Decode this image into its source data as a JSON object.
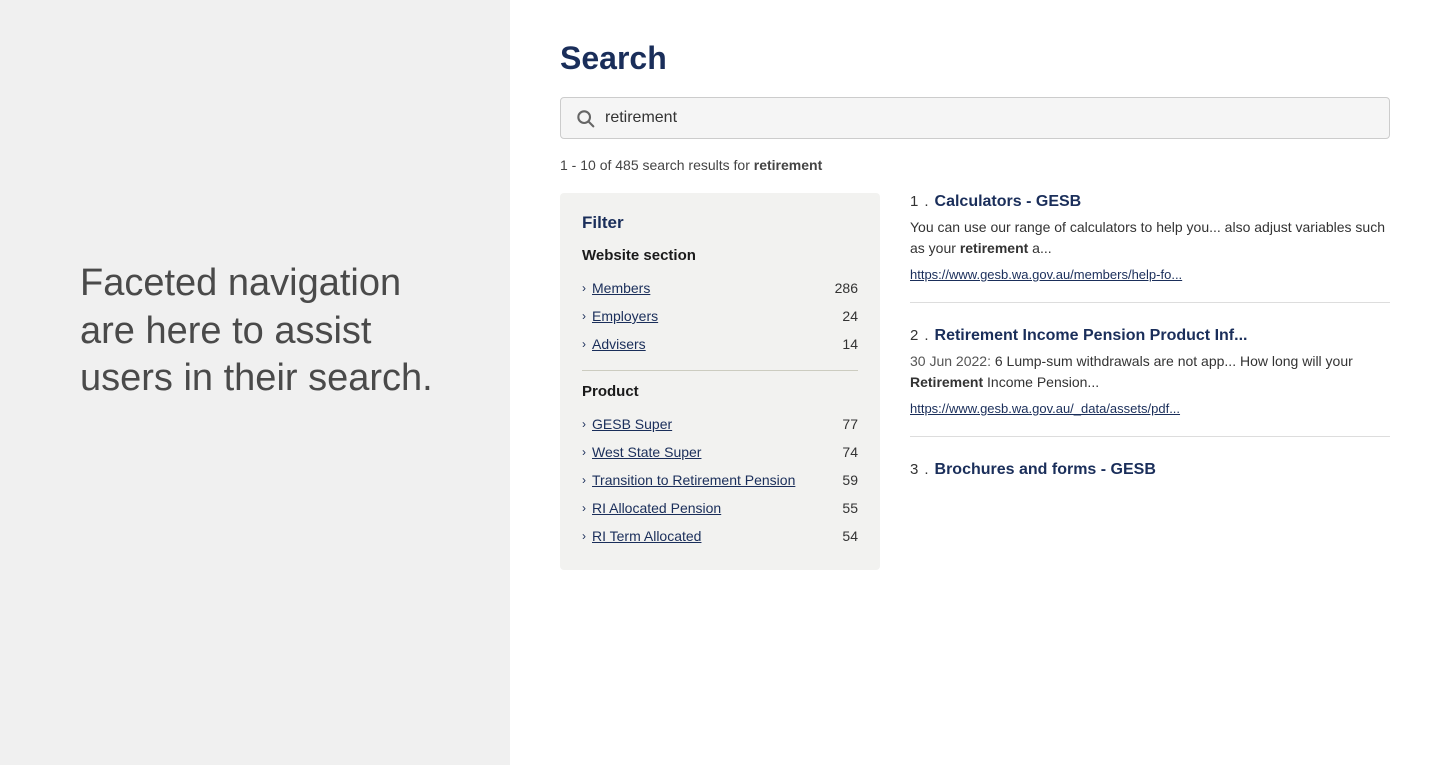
{
  "left_panel": {
    "description": "Faceted navigation are here to assist users in their search."
  },
  "search": {
    "heading": "Search",
    "query": "retirement",
    "results_summary_prefix": "1 - 10 of 485 search results for",
    "results_query_bold": "retirement"
  },
  "filter": {
    "title": "Filter",
    "sections": [
      {
        "label": "Website section",
        "items": [
          {
            "name": "Members",
            "count": 286
          },
          {
            "name": "Employers",
            "count": 24
          },
          {
            "name": "Advisers",
            "count": 14
          }
        ]
      },
      {
        "label": "Product",
        "items": [
          {
            "name": "GESB Super",
            "count": 77
          },
          {
            "name": "West State Super",
            "count": 74
          },
          {
            "name": "Transition to Retirement Pension",
            "count": 59
          },
          {
            "name": "RI Allocated Pension",
            "count": 55
          },
          {
            "name": "RI Term Allocated",
            "count": 54
          }
        ]
      }
    ]
  },
  "results": [
    {
      "number": "1",
      "title": "Calculators - GESB",
      "snippet": "You can use our range of calculators to help you... also adjust variables such as your retirement a...",
      "url": "https://www.gesb.wa.gov.au/members/help-fo...",
      "date": ""
    },
    {
      "number": "2",
      "title": "Retirement Income Pension Product Inf...",
      "snippet": "30 Jun 2022: 6 Lump-sum withdrawals are not app... How long will your Retirement Income Pension...",
      "url": "https://www.gesb.wa.gov.au/_data/assets/pdf...",
      "date": "30 Jun 2022"
    },
    {
      "number": "3",
      "title": "Brochures and forms - GESB",
      "snippet": "",
      "url": "",
      "date": ""
    }
  ],
  "icons": {
    "search": "🔍",
    "chevron_right": "›"
  }
}
